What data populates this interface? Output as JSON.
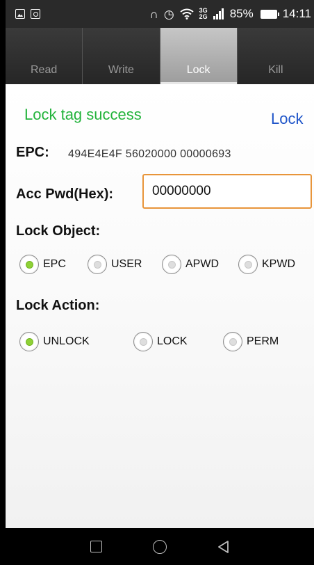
{
  "status_bar": {
    "battery": "85%",
    "time": "14:11",
    "network_top": "3G",
    "network_bottom": "2G",
    "icons": [
      "gallery-icon",
      "camera-notification-icon",
      "headset-icon",
      "alarm-icon",
      "wifi-icon",
      "signal-icon",
      "battery-icon"
    ]
  },
  "tabs": [
    {
      "label": "Read",
      "active": false
    },
    {
      "label": "Write",
      "active": false
    },
    {
      "label": "Lock",
      "active": true
    },
    {
      "label": "Kill",
      "active": false
    }
  ],
  "message": "Lock tag success",
  "lock_command": "Lock",
  "epc": {
    "label": "EPC:",
    "value": "494E4E4F 56020000 00000693"
  },
  "password": {
    "label": "Acc Pwd(Hex):",
    "value": "00000000"
  },
  "lock_object": {
    "label": "Lock Object:",
    "options": [
      "EPC",
      "USER",
      "APWD",
      "KPWD"
    ],
    "selected": "EPC"
  },
  "lock_action": {
    "label": "Lock Action:",
    "options": [
      "UNLOCK",
      "LOCK",
      "PERM"
    ],
    "selected": "UNLOCK"
  },
  "colors": {
    "success": "#22b33b",
    "link": "#1f55c9",
    "input_border": "#e8953a",
    "radio_selected": "#8fd137"
  },
  "nav_icons": [
    "recent-apps-icon",
    "home-icon",
    "back-icon"
  ]
}
